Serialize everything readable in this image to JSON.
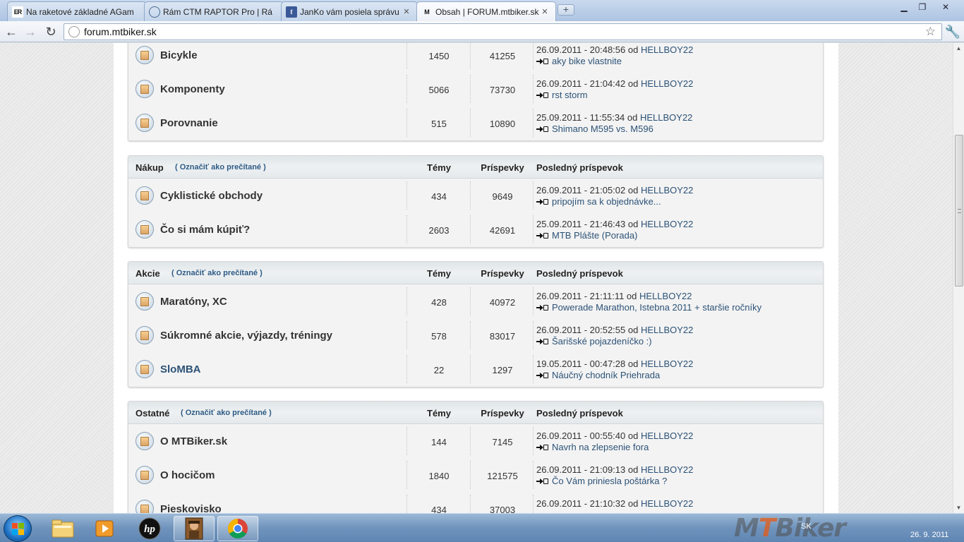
{
  "browser": {
    "tabs": [
      {
        "title": "Na raketové základné AGam",
        "icon": "er-icon",
        "active": false
      },
      {
        "title": "Rám CTM RAPTOR Pro | Rá",
        "icon": "globe-icon",
        "active": false
      },
      {
        "title": "JanKo vám posiela správu",
        "icon": "facebook-icon",
        "active": false
      },
      {
        "title": "Obsah | FORUM.mtbiker.sk",
        "icon": "mtbiker-icon",
        "active": true
      }
    ],
    "new_tab_label": "+",
    "url": "forum.mtbiker.sk"
  },
  "forum": {
    "sections": [
      {
        "name": "",
        "mark_read": "",
        "col_topics": "",
        "col_posts": "",
        "col_last": "",
        "forums": [
          {
            "name": "Bicykle",
            "topics": "1450",
            "posts": "41255",
            "last_date": "26.09.2011 - 20:48:56 od ",
            "last_user": "HELLBOY22",
            "last_topic": "aky bike vlastnite"
          },
          {
            "name": "Komponenty",
            "topics": "5066",
            "posts": "73730",
            "last_date": "26.09.2011 - 21:04:42 od ",
            "last_user": "HELLBOY22",
            "last_topic": "rst storm"
          },
          {
            "name": "Porovnanie",
            "topics": "515",
            "posts": "10890",
            "last_date": "25.09.2011 - 11:55:34 od ",
            "last_user": "HELLBOY22",
            "last_topic": "Shimano M595 vs. M596"
          }
        ]
      },
      {
        "name": "Nákup",
        "mark_read": "( Označiť ako prečítané )",
        "col_topics": "Témy",
        "col_posts": "Príspevky",
        "col_last": "Posledný príspevok",
        "forums": [
          {
            "name": "Cyklistické obchody",
            "topics": "434",
            "posts": "9649",
            "last_date": "26.09.2011 - 21:05:02 od ",
            "last_user": "HELLBOY22",
            "last_topic": "pripojím sa k objednávke..."
          },
          {
            "name": "Čo si mám kúpiť?",
            "topics": "2603",
            "posts": "42691",
            "last_date": "25.09.2011 - 21:46:43 od ",
            "last_user": "HELLBOY22",
            "last_topic": "MTB Plášte (Porada)"
          }
        ]
      },
      {
        "name": "Akcie",
        "mark_read": "( Označiť ako prečítané )",
        "col_topics": "Témy",
        "col_posts": "Príspevky",
        "col_last": "Posledný príspevok",
        "forums": [
          {
            "name": "Maratóny, XC",
            "topics": "428",
            "posts": "40972",
            "last_date": "26.09.2011 - 21:11:11 od ",
            "last_user": "HELLBOY22",
            "last_topic": "Powerade Marathon, Istebna 2011 + staršie ročníky"
          },
          {
            "name": "Súkromné akcie, výjazdy, tréningy",
            "topics": "578",
            "posts": "83017",
            "last_date": "26.09.2011 - 20:52:55 od ",
            "last_user": "HELLBOY22",
            "last_topic": "Šarišské pojazdeníčko :)"
          },
          {
            "name": "SloMBA",
            "topics": "22",
            "posts": "1297",
            "last_date": "19.05.2011 - 00:47:28 od ",
            "last_user": "HELLBOY22",
            "last_topic": "Náučný chodník Priehrada"
          }
        ]
      },
      {
        "name": "Ostatné",
        "mark_read": "( Označiť ako prečítané )",
        "col_topics": "Témy",
        "col_posts": "Príspevky",
        "col_last": "Posledný príspevok",
        "forums": [
          {
            "name": "O MTBiker.sk",
            "topics": "144",
            "posts": "7145",
            "last_date": "26.09.2011 - 00:55:40 od ",
            "last_user": "HELLBOY22",
            "last_topic": "Navrh na zlepsenie fora"
          },
          {
            "name": "O hocičom",
            "topics": "1840",
            "posts": "121575",
            "last_date": "26.09.2011 - 21:09:13 od ",
            "last_user": "HELLBOY22",
            "last_topic": "Čo Vám priniesla poštárka ?"
          },
          {
            "name": "Pieskovisko",
            "topics": "434",
            "posts": "37003",
            "last_date": "26.09.2011 - 21:10:32 od ",
            "last_user": "HELLBOY22",
            "last_topic": ""
          }
        ]
      }
    ]
  },
  "taskbar": {
    "apps": [
      "explorer-icon",
      "media-player-icon",
      "hp-icon",
      "game-icon",
      "chrome-icon"
    ],
    "lang": "SK",
    "date": "26. 9. 2011",
    "watermark": "MTBiker"
  },
  "colors": {
    "link": "#2c5277",
    "accent": "#2d5a86"
  }
}
